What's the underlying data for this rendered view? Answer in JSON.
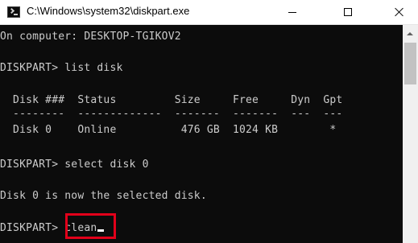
{
  "window": {
    "title": "C:\\Windows\\system32\\diskpart.exe",
    "icon": "console-icon"
  },
  "controls": {
    "minimize": "minimize-icon",
    "maximize": "maximize-icon",
    "close": "close-icon"
  },
  "console": {
    "computer_line": "On computer: DESKTOP-TGIKOV2",
    "cmd1": "DISKPART> list disk",
    "table_header": "  Disk ###  Status         Size     Free     Dyn  Gpt",
    "table_rule": "  --------  -------------  -------  -------  ---  ---",
    "table_row": "  Disk 0    Online          476 GB  1024 KB        *",
    "cmd2": "DISKPART> select disk 0",
    "result": "Disk 0 is now the selected disk.",
    "prompt": "DISKPART> ",
    "current_input": "clean"
  },
  "colors": {
    "console_background": "#0c0c0c",
    "console_text": "#cccccc",
    "highlight_border": "#e2001a"
  }
}
